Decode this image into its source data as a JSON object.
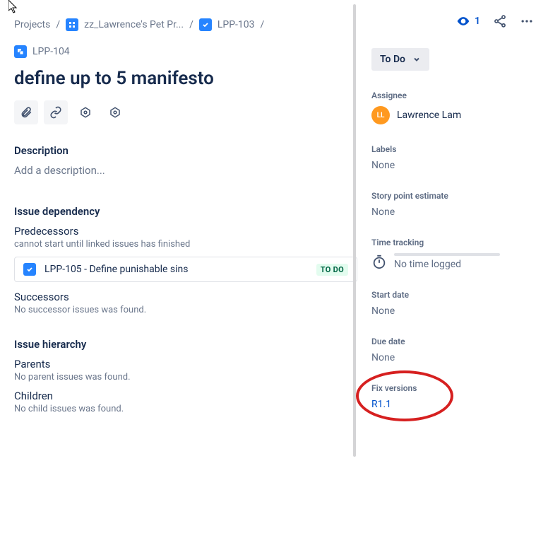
{
  "breadcrumb": {
    "root": "Projects",
    "project": "zz_Lawrence's Pet Pr...",
    "parent_issue": "LPP-103",
    "current_issue": "LPP-104"
  },
  "issue": {
    "title": "define up to 5 manifesto"
  },
  "description": {
    "heading": "Description",
    "placeholder": "Add a description..."
  },
  "dependency": {
    "heading": "Issue dependency",
    "predecessors_label": "Predecessors",
    "predecessors_hint": "cannot start until linked issues has finished",
    "linked": {
      "key_summary": "LPP-105 - Define punishable sins",
      "status": "TO DO"
    },
    "successors_label": "Successors",
    "successors_hint": "No successor issues was found."
  },
  "hierarchy": {
    "heading": "Issue hierarchy",
    "parents_label": "Parents",
    "parents_hint": "No parent issues was found.",
    "children_label": "Children",
    "children_hint": "No child issues was found."
  },
  "side": {
    "watch_count": "1",
    "status_button": "To Do",
    "assignee_label": "Assignee",
    "assignee_initials": "LL",
    "assignee_name": "Lawrence Lam",
    "labels_label": "Labels",
    "labels_value": "None",
    "story_label": "Story point estimate",
    "story_value": "None",
    "time_label": "Time tracking",
    "time_value": "No time logged",
    "start_label": "Start date",
    "start_value": "None",
    "due_label": "Due date",
    "due_value": "None",
    "fix_label": "Fix versions",
    "fix_value": "R1.1"
  }
}
